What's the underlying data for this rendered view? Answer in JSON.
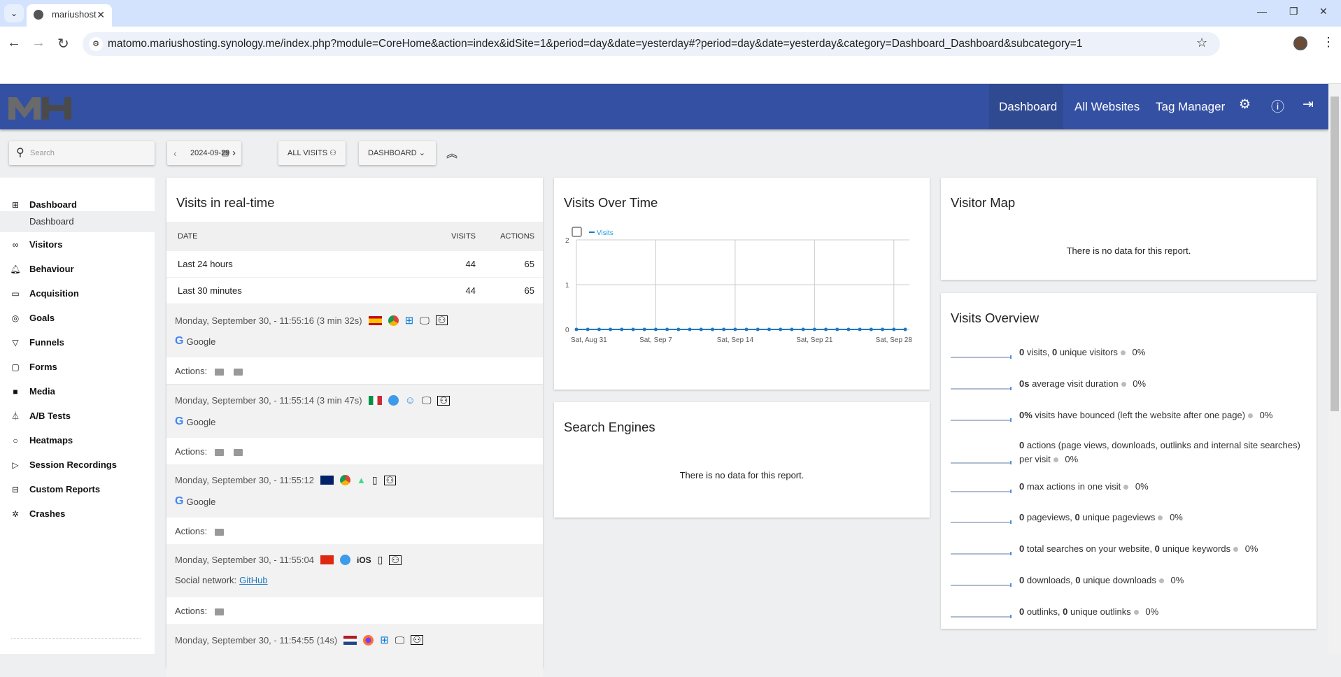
{
  "browser": {
    "tab_title": "mariushost",
    "url": "matomo.mariushosting.synology.me/index.php?module=CoreHome&action=index&idSite=1&period=day&date=yesterday#?period=day&date=yesterday&category=Dashboard_Dashboard&subcategory=1"
  },
  "header": {
    "logo": "MH",
    "nav": [
      "Dashboard",
      "All Websites",
      "Tag Manager"
    ],
    "icons": [
      "gear-icon",
      "info-icon",
      "logout-icon"
    ]
  },
  "toolbar": {
    "search_placeholder": "Search",
    "date": "2024-09-29",
    "segment": "ALL VISITS",
    "dashboard": "DASHBOARD"
  },
  "sidebar": {
    "items": [
      {
        "label": "Dashboard",
        "icon": "grid-icon"
      },
      {
        "label": "Dashboard",
        "sub": true
      },
      {
        "label": "Visitors",
        "icon": "glasses-icon"
      },
      {
        "label": "Behaviour",
        "icon": "bell-icon"
      },
      {
        "label": "Acquisition",
        "icon": "window-icon"
      },
      {
        "label": "Goals",
        "icon": "target-icon"
      },
      {
        "label": "Funnels",
        "icon": "funnel-icon"
      },
      {
        "label": "Forms",
        "icon": "clipboard-icon"
      },
      {
        "label": "Media",
        "icon": "media-icon"
      },
      {
        "label": "A/B Tests",
        "icon": "flask-icon"
      },
      {
        "label": "Heatmaps",
        "icon": "drop-icon"
      },
      {
        "label": "Session Recordings",
        "icon": "play-icon"
      },
      {
        "label": "Custom Reports",
        "icon": "briefcase-icon"
      },
      {
        "label": "Crashes",
        "icon": "bug-icon"
      }
    ]
  },
  "realtime": {
    "title": "Visits in real-time",
    "columns": [
      "DATE",
      "VISITS",
      "ACTIONS"
    ],
    "rows": [
      {
        "label": "Last 24 hours",
        "visits": "44",
        "actions": "65"
      },
      {
        "label": "Last 30 minutes",
        "visits": "44",
        "actions": "65"
      }
    ],
    "actions_label": "Actions:",
    "visits": [
      {
        "time": "Monday, September 30, - 11:55:16 (3 min 32s)",
        "country": "Spain",
        "browser": "Chrome",
        "os": "Windows",
        "device": "desktop",
        "source": "Google",
        "actions": 2
      },
      {
        "time": "Monday, September 30, - 11:55:14 (3 min 47s)",
        "country": "Italy",
        "browser": "Safari",
        "os": "macOS",
        "device": "desktop",
        "source": "Google",
        "actions": 2
      },
      {
        "time": "Monday, September 30, - 11:55:12",
        "country": "United Kingdom",
        "browser": "Chrome",
        "os": "Android",
        "device": "smartphone",
        "source": "Google",
        "actions": 1
      },
      {
        "time": "Monday, September 30, - 11:55:04",
        "country": "China",
        "browser": "Safari",
        "os": "iOS",
        "device": "smartphone",
        "source_prefix": "Social network:",
        "source": "GitHub",
        "actions": 1
      },
      {
        "time": "Monday, September 30, - 11:54:55 (14s)",
        "country": "Netherlands",
        "browser": "Firefox",
        "os": "Windows",
        "device": "desktop"
      }
    ]
  },
  "visits_over_time": {
    "title": "Visits Over Time"
  },
  "search_engines": {
    "title": "Search Engines",
    "empty": "There is no data for this report."
  },
  "visitor_map": {
    "title": "Visitor Map",
    "empty": "There is no data for this report."
  },
  "overview": {
    "title": "Visits Overview",
    "rows": [
      {
        "html": "<b>0</b> visits, <b>0</b> unique visitors",
        "pct": "0%"
      },
      {
        "html": "<b>0s</b> average visit duration",
        "pct": "0%"
      },
      {
        "html": "<b>0%</b> visits have bounced (left the website after one page)",
        "pct": "0%"
      },
      {
        "html": "<b>0</b> actions (page views, downloads, outlinks and internal site searches) per visit",
        "pct": "0%"
      },
      {
        "html": "<b>0</b> max actions in one visit",
        "pct": "0%"
      },
      {
        "html": "<b>0</b> pageviews, <b>0</b> unique pageviews",
        "pct": "0%"
      },
      {
        "html": "<b>0</b> total searches on your website, <b>0</b> unique keywords",
        "pct": "0%"
      },
      {
        "html": "<b>0</b> downloads, <b>0</b> unique downloads",
        "pct": "0%"
      },
      {
        "html": "<b>0</b> outlinks, <b>0</b> unique outlinks",
        "pct": "0%"
      }
    ]
  },
  "chart_data": {
    "type": "line",
    "series": [
      {
        "name": "Visits",
        "values": [
          0,
          0,
          0,
          0,
          0,
          0,
          0,
          0,
          0,
          0,
          0,
          0,
          0,
          0,
          0,
          0,
          0,
          0,
          0,
          0,
          0,
          0,
          0,
          0,
          0,
          0,
          0,
          0,
          0,
          0
        ]
      }
    ],
    "x_start": "2024-08-31",
    "x_end": "2024-09-29",
    "xticks": [
      "Sat, Aug 31",
      "Sat, Sep 7",
      "Sat, Sep 14",
      "Sat, Sep 21",
      "Sat, Sep 28"
    ],
    "yticks": [
      "0",
      "1",
      "2"
    ],
    "ylim": [
      0,
      2
    ],
    "grid": true,
    "color": "#1f78c1",
    "legend": "top-left"
  }
}
